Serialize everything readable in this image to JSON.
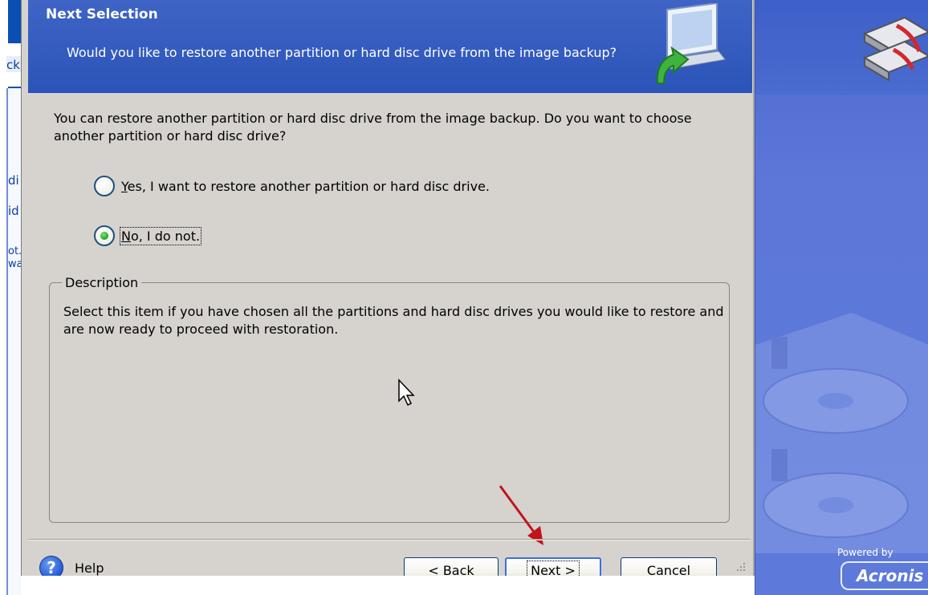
{
  "left_app": {
    "fragments": [
      "ck",
      "di",
      "id",
      "ot.",
      "wa"
    ]
  },
  "dialog": {
    "title": "Next Selection",
    "subtitle": "Would you like to restore another partition or hard disc drive from the image backup?",
    "intro": "You can restore another partition or hard disc drive from the image backup. Do you want to choose another partition or hard disc drive?",
    "options": [
      {
        "label_underlined": "Y",
        "label_rest": "es, I want to restore another partition or hard disc drive.",
        "checked": false
      },
      {
        "label_underlined": "N",
        "label_rest": "o, I do not.",
        "checked": true
      }
    ],
    "description_legend": "Description",
    "description_text": "Select this item if you have chosen all the partitions and hard disc drives you would like to restore and are now ready to proceed with restoration.",
    "help_label": "Help",
    "help_icon": "question-icon",
    "buttons": {
      "back": "< Back",
      "next": "Next >",
      "cancel": "Cancel"
    }
  },
  "brand": {
    "powered_by": "Powered by",
    "name": "Acronis"
  },
  "colors": {
    "banner": "#2b54b8",
    "dialog_bg": "#d6d3ce",
    "right_panel": "#5c77d8",
    "annotation_arrow": "#c0141c"
  }
}
